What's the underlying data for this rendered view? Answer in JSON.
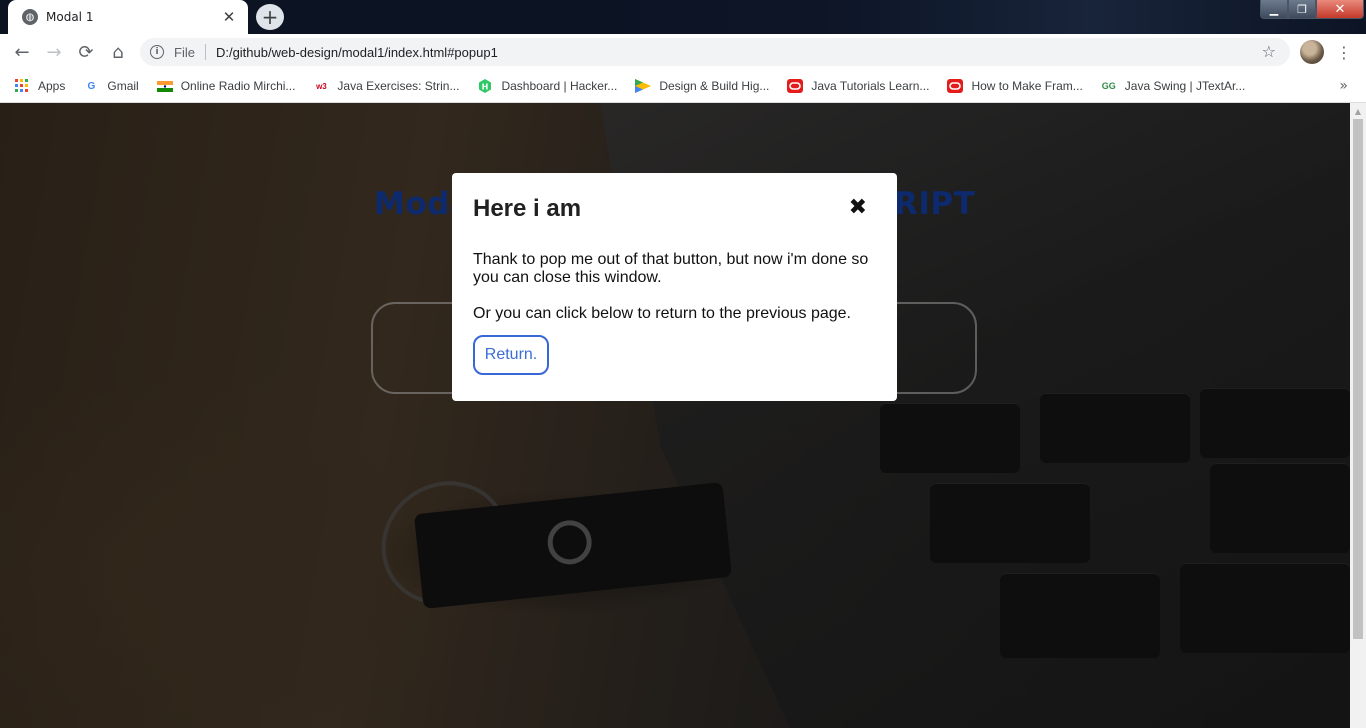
{
  "browser": {
    "tab_title": "Modal 1",
    "tab_close": "✕",
    "new_tab": "+",
    "window_controls": {
      "minimize": "▁",
      "maximize": "❐",
      "close": "✕"
    },
    "nav": {
      "back": "←",
      "forward": "→",
      "reload": "⟳",
      "home": "⌂"
    },
    "address": {
      "info_icon": "i",
      "scheme": "File",
      "url": "D:/github/web-design/modal1/index.html#popup1"
    },
    "star": "☆",
    "menu": "⋮",
    "bookmarks_more": "»",
    "bookmarks": [
      {
        "label": "Apps",
        "icon": "apps-grid-icon"
      },
      {
        "label": "Gmail",
        "icon": "google-g-icon"
      },
      {
        "label": "Online Radio Mirchi...",
        "icon": "india-flag-icon"
      },
      {
        "label": "Java Exercises: Strin...",
        "icon": "w3resource-icon"
      },
      {
        "label": "Dashboard | Hacker...",
        "icon": "hackerrank-icon"
      },
      {
        "label": "Design & Build Hig...",
        "icon": "google-ads-icon"
      },
      {
        "label": "Java Tutorials Learn...",
        "icon": "oracle-icon"
      },
      {
        "label": "How to Make Fram...",
        "icon": "oracle-icon"
      },
      {
        "label": "Java Swing | JTextAr...",
        "icon": "geeksforgeeks-icon"
      }
    ]
  },
  "page": {
    "heading_left": "Moda",
    "heading_right": "RIPT"
  },
  "modal": {
    "title": "Here i am",
    "close_glyph": "✖",
    "paragraph_1": "Thank to pop me out of that button, but now i'm done so you can close this window.",
    "paragraph_2": "Or you can click below to return to the previous page.",
    "return_label": "Return."
  },
  "colors": {
    "heading": "#0d2a6e",
    "return_border": "#3867d6",
    "return_text": "#3b6fd4"
  }
}
